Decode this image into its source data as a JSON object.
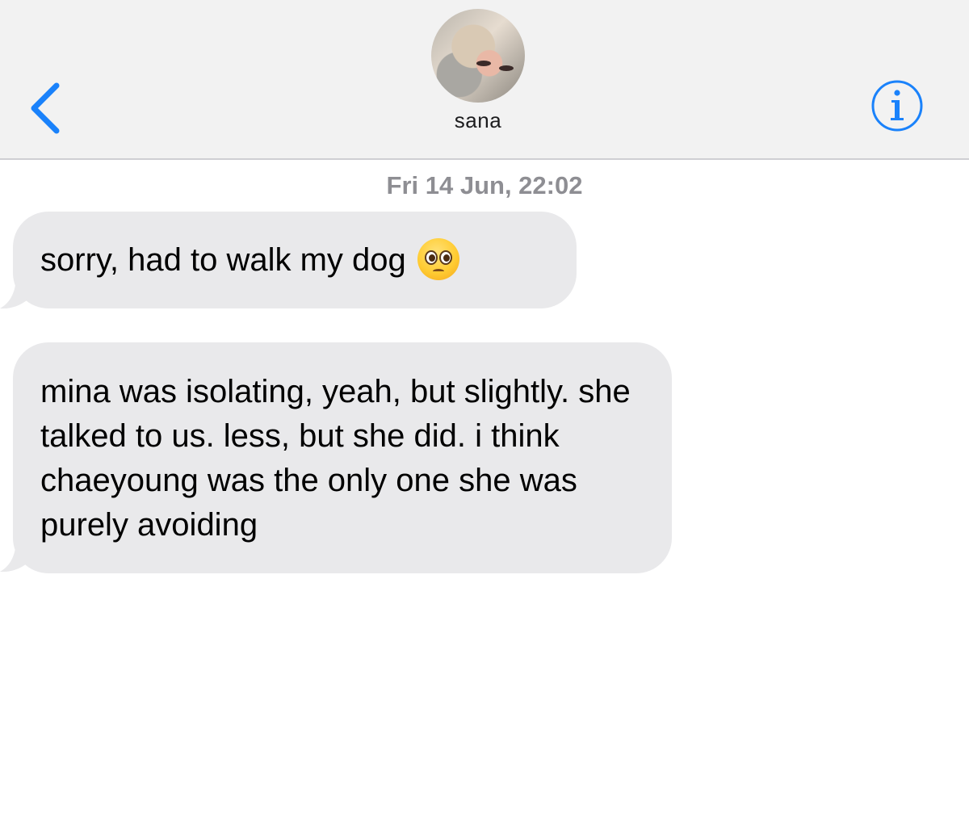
{
  "header": {
    "contact_name": "sana",
    "avatar_icon": "contact-avatar",
    "back_icon": "chevron-left-icon",
    "info_icon": "info-icon",
    "accent_color": "#1a82fb"
  },
  "conversation": {
    "timestamp": "Fri 14 Jun, 22:02",
    "messages": [
      {
        "direction": "incoming",
        "text": "sorry, had to walk my dog",
        "emoji": "pleading-face-emoji"
      },
      {
        "direction": "incoming",
        "text": "mina was isolating, yeah, but slightly. she talked to us. less, but she did. i think chaeyoung was the only one she was purely avoiding"
      }
    ],
    "bubble_color": "#e9e9eb"
  }
}
